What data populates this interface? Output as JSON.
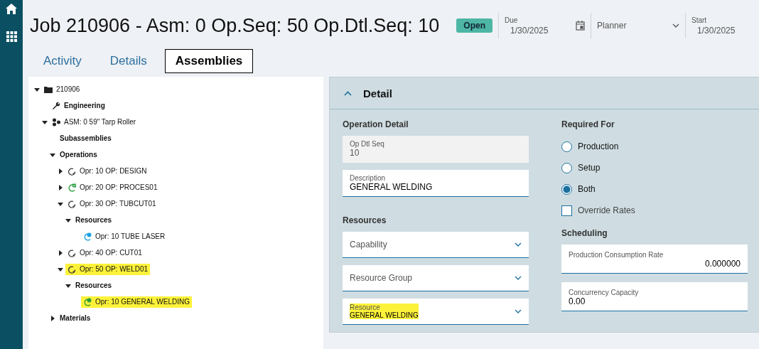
{
  "title": "Job 210906 - Asm: 0 Op.Seq: 50 Op.Dtl.Seq: 10",
  "status": "Open",
  "header_fields": [
    {
      "kind": "date",
      "label": "Due",
      "value": "1/30/2025"
    },
    {
      "kind": "select",
      "value": "Planner"
    },
    {
      "kind": "text",
      "label": "Start",
      "value": "1/30/2025"
    }
  ],
  "tabs": [
    {
      "label": "Activity",
      "selected": false
    },
    {
      "label": "Details",
      "selected": false
    },
    {
      "label": "Assemblies",
      "selected": true
    }
  ],
  "tree": [
    {
      "label": "210906",
      "kind": "folder",
      "expanded": true,
      "highlighted": false,
      "children": [
        {
          "label": "Engineering",
          "kind": "wrench",
          "highlighted": false
        },
        {
          "label": "ASM: 0 59\" Tarp Roller",
          "kind": "assembly",
          "expanded": true,
          "highlighted": false,
          "children": [
            {
              "label": "Subassemblies",
              "kind": "group",
              "highlighted": false
            },
            {
              "label": "Operations",
              "kind": "group",
              "expanded": true,
              "highlighted": false,
              "children": [
                {
                  "label": "Opr: 10 OP: DESIGN",
                  "kind": "operation",
                  "expanded": false,
                  "highlighted": false
                },
                {
                  "label": "Opr: 20 OP: PROCES01",
                  "kind": "operation-done",
                  "expanded": false,
                  "highlighted": false
                },
                {
                  "label": "Opr: 30 OP: TUBCUT01",
                  "kind": "operation",
                  "expanded": true,
                  "highlighted": false,
                  "children": [
                    {
                      "label": "Resources",
                      "kind": "group",
                      "expanded": true,
                      "highlighted": false,
                      "children": [
                        {
                          "label": "Opr: 10 TUBE LASER",
                          "kind": "resource",
                          "color": "#1ba1e2",
                          "highlighted": false
                        }
                      ]
                    }
                  ]
                },
                {
                  "label": "Opr: 40 OP: CUT01",
                  "kind": "operation",
                  "expanded": false,
                  "highlighted": false
                },
                {
                  "label": "Opr: 50 OP: WELD01",
                  "kind": "operation",
                  "expanded": true,
                  "highlighted": true,
                  "children": [
                    {
                      "label": "Resources",
                      "kind": "group",
                      "expanded": true,
                      "highlighted": false,
                      "children": [
                        {
                          "label": "Opr: 10 GENERAL WELDING",
                          "kind": "resource",
                          "color": "#2e9e3e",
                          "highlighted": true
                        }
                      ]
                    }
                  ]
                }
              ]
            },
            {
              "label": "Materials",
              "kind": "group",
              "expanded": false,
              "highlighted": false
            }
          ]
        }
      ]
    }
  ],
  "detail": {
    "title": "Detail",
    "expanded": true,
    "operation_detail": {
      "heading": "Operation Detail",
      "fields": [
        {
          "label": "Op Dtl Seq",
          "value": "10",
          "disabled": true
        },
        {
          "label": "Description",
          "value": "GENERAL WELDING",
          "disabled": false
        }
      ]
    },
    "resources": {
      "heading": "Resources",
      "dropdowns": [
        {
          "placeholder": "Capability",
          "highlighted": false
        },
        {
          "placeholder": "Resource Group",
          "highlighted": false
        },
        {
          "label": "Resource",
          "value": "GENERAL WELDING",
          "highlighted": true
        }
      ]
    },
    "required_for": {
      "heading": "Required For",
      "options": [
        {
          "label": "Production",
          "selected": false
        },
        {
          "label": "Setup",
          "selected": false
        },
        {
          "label": "Both",
          "selected": true
        }
      ]
    },
    "override_rates": {
      "label": "Override Rates",
      "checked": false
    },
    "scheduling": {
      "heading": "Scheduling",
      "fields": [
        {
          "label": "Production Consumption Rate",
          "value": "0.000000"
        },
        {
          "label": "Concurrency Capacity",
          "value": "0.00"
        }
      ]
    }
  }
}
